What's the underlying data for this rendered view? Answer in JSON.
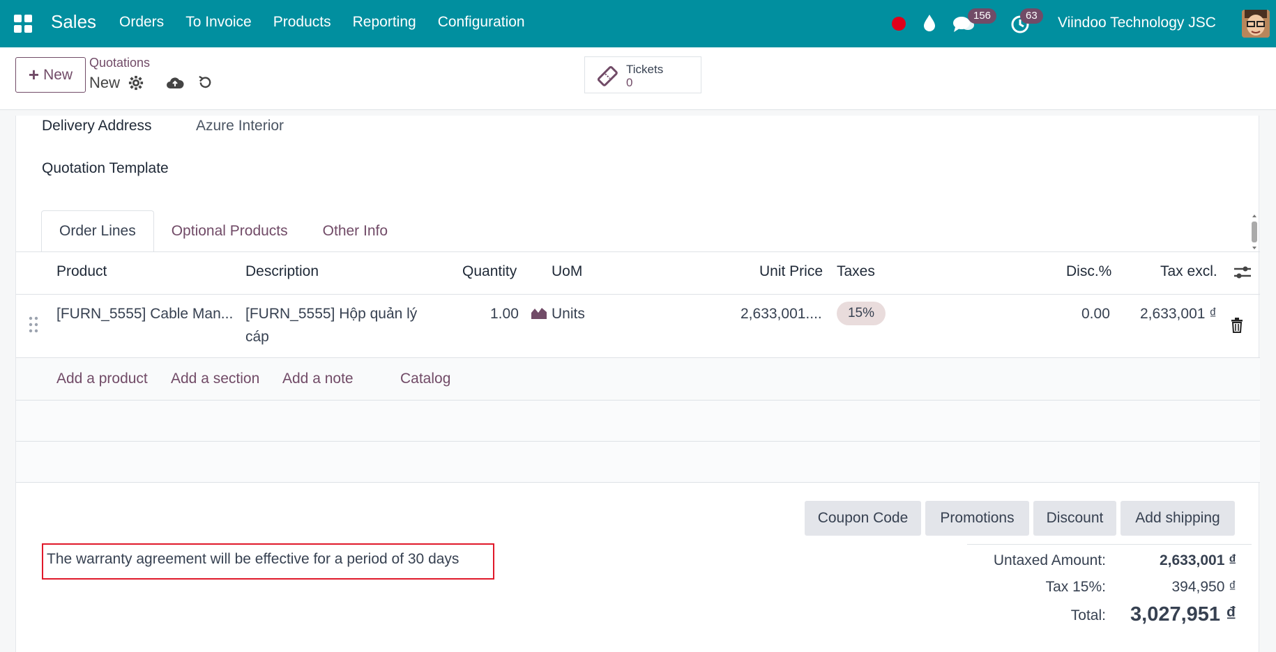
{
  "navbar": {
    "brand": "Sales",
    "menu": [
      "Orders",
      "To Invoice",
      "Products",
      "Reporting",
      "Configuration"
    ],
    "messages_count": "156",
    "activities_count": "63",
    "company": "Viindoo Technology JSC"
  },
  "control": {
    "new_label": "New",
    "breadcrumb": "Quotations",
    "record_name": "New",
    "smart_button": {
      "label": "Tickets",
      "value": "0"
    }
  },
  "form": {
    "delivery_address_label": "Delivery Address",
    "delivery_address_value": "Azure Interior",
    "quotation_template_label": "Quotation Template"
  },
  "tabs": [
    "Order Lines",
    "Optional Products",
    "Other Info"
  ],
  "table": {
    "headers": {
      "product": "Product",
      "description": "Description",
      "quantity": "Quantity",
      "uom": "UoM",
      "unit_price": "Unit Price",
      "taxes": "Taxes",
      "discount": "Disc.%",
      "tax_excl": "Tax excl."
    },
    "rows": [
      {
        "product": "[FURN_5555] Cable Man...",
        "description_line1": "[FURN_5555] Hộp quản lý",
        "description_line2": "cáp",
        "quantity": "1.00",
        "uom": "Units",
        "unit_price": "2,633,001....",
        "tax": "15%",
        "discount": "0.00",
        "subtotal": "2,633,001 ₫"
      }
    ],
    "add_links": {
      "add_product": "Add a product",
      "add_section": "Add a section",
      "add_note": "Add a note",
      "catalog": "Catalog"
    }
  },
  "actions": {
    "coupon": "Coupon Code",
    "promotions": "Promotions",
    "discount": "Discount",
    "shipping": "Add shipping"
  },
  "note": "The warranty agreement will be effective for a period of 30 days",
  "totals": {
    "untaxed_label": "Untaxed Amount:",
    "untaxed_value": "2,633,001 ₫",
    "tax_label": "Tax 15%:",
    "tax_value": "394,950 ₫",
    "total_label": "Total:",
    "total_value": "3,027,951 ₫"
  },
  "colors": {
    "navbar": "#018f9f",
    "primary": "#714b67",
    "highlight_border": "#e0192a"
  }
}
